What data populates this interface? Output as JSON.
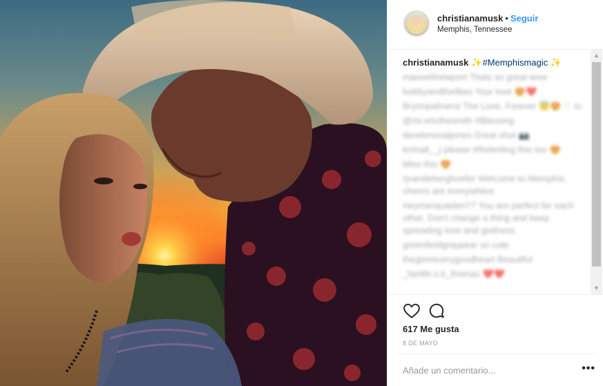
{
  "post": {
    "photo_alt": "",
    "username": "christianamusk",
    "separator": "•",
    "follow_label": "Seguir",
    "location": "Memphis, Tennessee"
  },
  "caption": {
    "username": "christianamusk",
    "spark_left": "✨",
    "hashtag": "#Memphismagic",
    "spark_right": "✨"
  },
  "comments": [
    "maxwellnewport Thats so great wow",
    "bobbyandthelikes Your love 😍❤️",
    "Brynnpalmerst The Love, Forever 😇😍 ♡ to",
    "@mr.ericthesmith #Blessing",
    "derekmonatjones Great shot 📷",
    "kmhalt__j please #Relenting this too 😍",
    "Miss this 😍",
    "rjvandeberghoefer Welcome to Memphis, cheers are everywhere",
    "Heymerquaiden77 You are perfect for each other. Don't change a thing and keep spreading love and godness",
    "greenfieldgraypear so cute",
    "thegimreverygoodheart Beautiful",
    "_fairlife.s.k_thomas  ❤️❤️"
  ],
  "actions": {
    "like_icon": "heart-outline-icon",
    "comment_icon": "speech-bubble-icon"
  },
  "likes_text": "617 Me gusta",
  "date_text": "8 DE MAYO",
  "add_comment_placeholder": "Añade un comentario...",
  "more_label": "•••",
  "scroll": {
    "up": "▲",
    "down": "▼"
  },
  "colors": {
    "link": "#3897f0",
    "hashtag": "#003569",
    "muted": "#999999",
    "border": "#efefef"
  }
}
